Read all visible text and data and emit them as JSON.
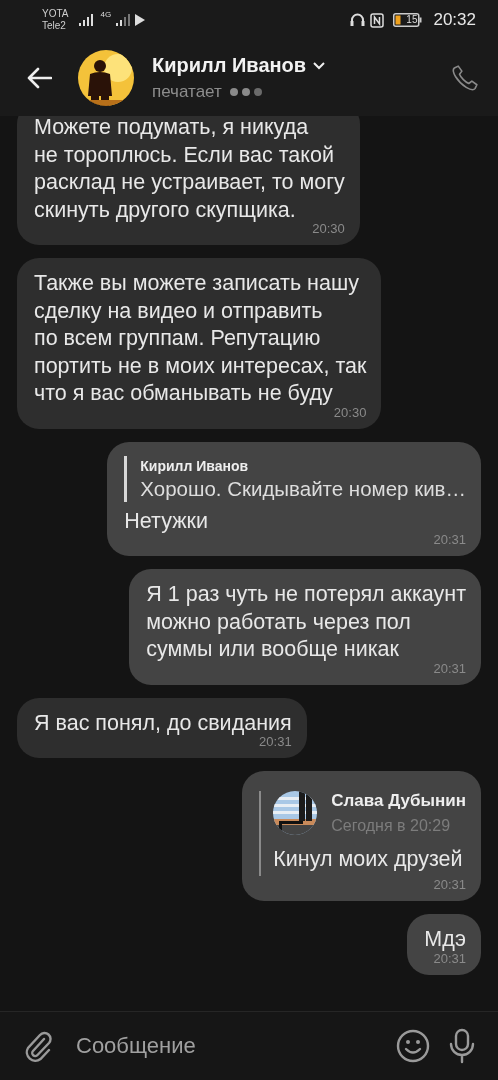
{
  "status_bar": {
    "carriers": [
      "YOTA",
      "Tele2"
    ],
    "network": "4G",
    "battery": "15",
    "time": "20:32"
  },
  "header": {
    "name": "Кирилл Иванов",
    "status": "печатает"
  },
  "messages": [
    {
      "kind": "incoming",
      "text": "Можете подумать, я никуда\nне тороплюсь. Если вас такой\nрасклад не устраивает, то могу\nскинуть другого скупщика.",
      "time": "20:30"
    },
    {
      "kind": "incoming",
      "text": "Также вы можете записать нашу\nсделку на видео и отправить\nпо всем группам. Репутацию\nпортить не в моих интересах, так\nчто я вас обманывать не буду",
      "time": "20:30"
    },
    {
      "kind": "outgoing",
      "quote": {
        "kind": "reply",
        "author": "Кирилл Иванов",
        "text": "Хорошо. Скидывайте номер кив…"
      },
      "text": "Нетужки",
      "time": "20:31"
    },
    {
      "kind": "outgoing",
      "text": "Я 1 раз чуть не потерял аккаунт\nможно работать через пол\nсуммы или вообще никак",
      "time": "20:31"
    },
    {
      "kind": "incoming",
      "text": "Я вас понял, до свидания",
      "time": "20:31"
    },
    {
      "kind": "outgoing",
      "quote": {
        "kind": "forward",
        "author": "Слава Дубынин",
        "date": "Сегодня в 20:29",
        "text": "Кинул моих друзей"
      },
      "time": "20:31"
    },
    {
      "kind": "outgoing",
      "text": "Мдэ",
      "time": "20:31"
    }
  ],
  "composer": {
    "placeholder": "Сообщение"
  }
}
